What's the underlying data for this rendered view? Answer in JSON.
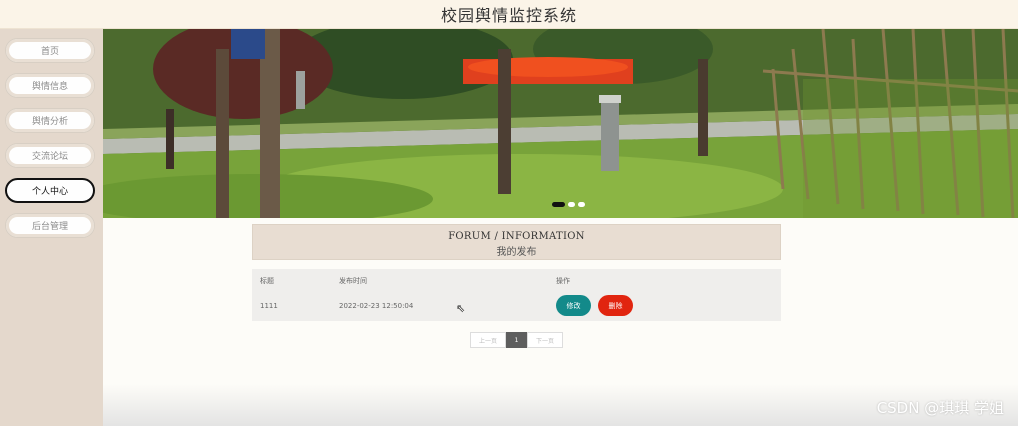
{
  "header": {
    "title": "校园舆情监控系统"
  },
  "sidebar": {
    "items": [
      {
        "label": "首页"
      },
      {
        "label": "舆情信息"
      },
      {
        "label": "舆情分析"
      },
      {
        "label": "交流论坛"
      },
      {
        "label": "个人中心",
        "active": true
      },
      {
        "label": "后台管理"
      }
    ]
  },
  "banner": {
    "slide_count": 3,
    "active_slide": 1
  },
  "section": {
    "title_en": "FORUM / INFORMATION",
    "title_cn": "我的发布"
  },
  "table": {
    "columns": [
      "标题",
      "发布时间",
      "操作"
    ],
    "rows": [
      {
        "title": "1111",
        "time": "2022-02-23 12:50:04",
        "edit_label": "修改",
        "delete_label": "删除"
      }
    ]
  },
  "pagination": {
    "prev": "上一页",
    "current": "1",
    "next": "下一页"
  },
  "watermark": "CSDN @琪琪 学姐",
  "colors": {
    "edit": "#138a8a",
    "delete": "#e1250f",
    "sidebar": "#e4d8cc",
    "header": "#fbf4e8"
  }
}
